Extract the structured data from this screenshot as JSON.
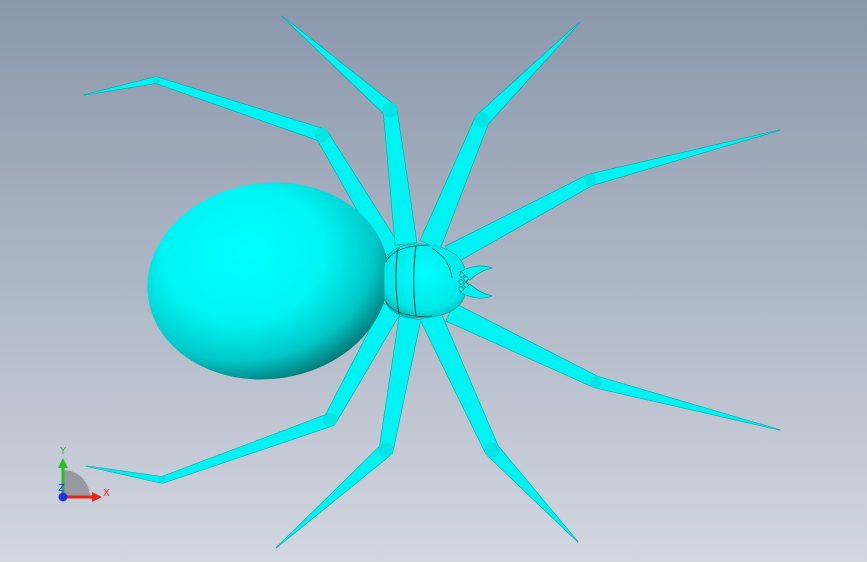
{
  "viewport": {
    "background_top": "#8a97ab",
    "background_bottom": "#d2d7e0"
  },
  "model": {
    "color": "#00ffff",
    "shadow_color": "#003c3c"
  },
  "triad": {
    "x_label": "X",
    "y_label": "Y",
    "z_label": "Z",
    "x_color": "#e8261d",
    "y_color": "#2bbd2b",
    "z_color": "#2233dd"
  }
}
